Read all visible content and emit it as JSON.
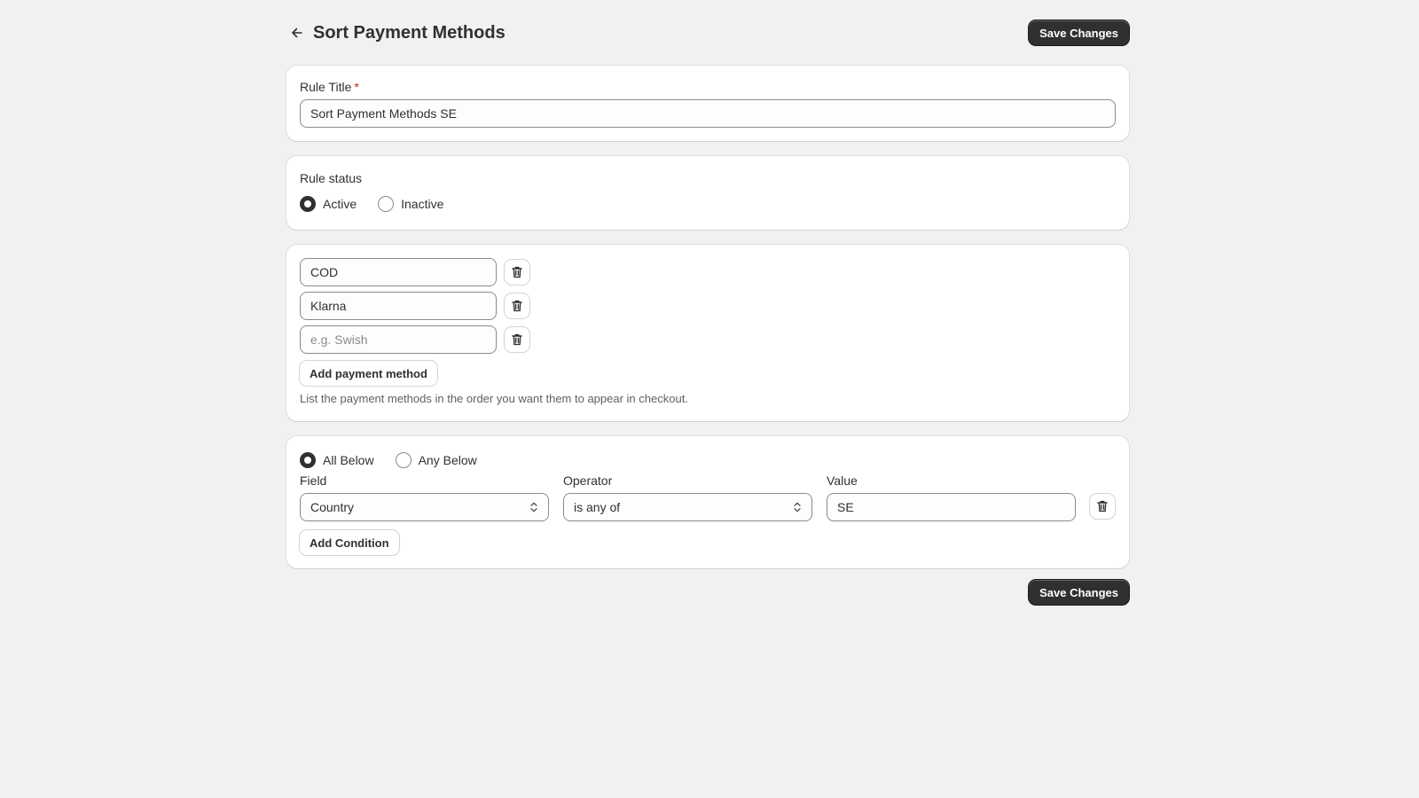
{
  "header": {
    "title": "Sort Payment Methods",
    "save_label": "Save Changes",
    "back_icon": "arrow-left-icon"
  },
  "rule_title": {
    "label": "Rule Title",
    "required_mark": "*",
    "value": "Sort Payment Methods SE"
  },
  "rule_status": {
    "label": "Rule status",
    "options": [
      {
        "label": "Active",
        "checked": true
      },
      {
        "label": "Inactive",
        "checked": false
      }
    ]
  },
  "payment_methods": {
    "items": [
      {
        "value": "COD",
        "placeholder": ""
      },
      {
        "value": "Klarna",
        "placeholder": ""
      },
      {
        "value": "",
        "placeholder": "e.g. Swish"
      }
    ],
    "delete_icon": "trash-icon",
    "add_label": "Add payment method",
    "help_text": "List the payment methods in the order you want them to appear in checkout."
  },
  "conditions": {
    "match_options": [
      {
        "label": "All Below",
        "checked": true
      },
      {
        "label": "Any Below",
        "checked": false
      }
    ],
    "field_label": "Field",
    "operator_label": "Operator",
    "value_label": "Value",
    "rows": [
      {
        "field": "Country",
        "operator": "is any of",
        "value": "SE"
      }
    ],
    "add_label": "Add Condition"
  },
  "footer": {
    "save_label": "Save Changes"
  },
  "colors": {
    "background": "#f1f1f1",
    "primary_button": "#303030",
    "required": "#c5280c"
  }
}
